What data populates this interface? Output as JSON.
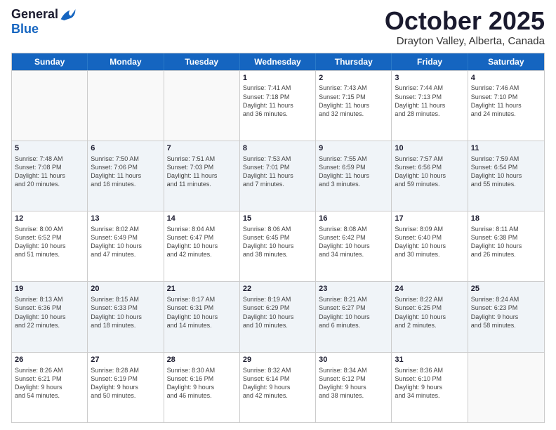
{
  "header": {
    "logo_general": "General",
    "logo_blue": "Blue",
    "month_title": "October 2025",
    "subtitle": "Drayton Valley, Alberta, Canada"
  },
  "days_of_week": [
    "Sunday",
    "Monday",
    "Tuesday",
    "Wednesday",
    "Thursday",
    "Friday",
    "Saturday"
  ],
  "rows": [
    {
      "alt": false,
      "cells": [
        {
          "day": "",
          "info": ""
        },
        {
          "day": "",
          "info": ""
        },
        {
          "day": "",
          "info": ""
        },
        {
          "day": "1",
          "info": "Sunrise: 7:41 AM\nSunset: 7:18 PM\nDaylight: 11 hours\nand 36 minutes."
        },
        {
          "day": "2",
          "info": "Sunrise: 7:43 AM\nSunset: 7:15 PM\nDaylight: 11 hours\nand 32 minutes."
        },
        {
          "day": "3",
          "info": "Sunrise: 7:44 AM\nSunset: 7:13 PM\nDaylight: 11 hours\nand 28 minutes."
        },
        {
          "day": "4",
          "info": "Sunrise: 7:46 AM\nSunset: 7:10 PM\nDaylight: 11 hours\nand 24 minutes."
        }
      ]
    },
    {
      "alt": true,
      "cells": [
        {
          "day": "5",
          "info": "Sunrise: 7:48 AM\nSunset: 7:08 PM\nDaylight: 11 hours\nand 20 minutes."
        },
        {
          "day": "6",
          "info": "Sunrise: 7:50 AM\nSunset: 7:06 PM\nDaylight: 11 hours\nand 16 minutes."
        },
        {
          "day": "7",
          "info": "Sunrise: 7:51 AM\nSunset: 7:03 PM\nDaylight: 11 hours\nand 11 minutes."
        },
        {
          "day": "8",
          "info": "Sunrise: 7:53 AM\nSunset: 7:01 PM\nDaylight: 11 hours\nand 7 minutes."
        },
        {
          "day": "9",
          "info": "Sunrise: 7:55 AM\nSunset: 6:59 PM\nDaylight: 11 hours\nand 3 minutes."
        },
        {
          "day": "10",
          "info": "Sunrise: 7:57 AM\nSunset: 6:56 PM\nDaylight: 10 hours\nand 59 minutes."
        },
        {
          "day": "11",
          "info": "Sunrise: 7:59 AM\nSunset: 6:54 PM\nDaylight: 10 hours\nand 55 minutes."
        }
      ]
    },
    {
      "alt": false,
      "cells": [
        {
          "day": "12",
          "info": "Sunrise: 8:00 AM\nSunset: 6:52 PM\nDaylight: 10 hours\nand 51 minutes."
        },
        {
          "day": "13",
          "info": "Sunrise: 8:02 AM\nSunset: 6:49 PM\nDaylight: 10 hours\nand 47 minutes."
        },
        {
          "day": "14",
          "info": "Sunrise: 8:04 AM\nSunset: 6:47 PM\nDaylight: 10 hours\nand 42 minutes."
        },
        {
          "day": "15",
          "info": "Sunrise: 8:06 AM\nSunset: 6:45 PM\nDaylight: 10 hours\nand 38 minutes."
        },
        {
          "day": "16",
          "info": "Sunrise: 8:08 AM\nSunset: 6:42 PM\nDaylight: 10 hours\nand 34 minutes."
        },
        {
          "day": "17",
          "info": "Sunrise: 8:09 AM\nSunset: 6:40 PM\nDaylight: 10 hours\nand 30 minutes."
        },
        {
          "day": "18",
          "info": "Sunrise: 8:11 AM\nSunset: 6:38 PM\nDaylight: 10 hours\nand 26 minutes."
        }
      ]
    },
    {
      "alt": true,
      "cells": [
        {
          "day": "19",
          "info": "Sunrise: 8:13 AM\nSunset: 6:36 PM\nDaylight: 10 hours\nand 22 minutes."
        },
        {
          "day": "20",
          "info": "Sunrise: 8:15 AM\nSunset: 6:33 PM\nDaylight: 10 hours\nand 18 minutes."
        },
        {
          "day": "21",
          "info": "Sunrise: 8:17 AM\nSunset: 6:31 PM\nDaylight: 10 hours\nand 14 minutes."
        },
        {
          "day": "22",
          "info": "Sunrise: 8:19 AM\nSunset: 6:29 PM\nDaylight: 10 hours\nand 10 minutes."
        },
        {
          "day": "23",
          "info": "Sunrise: 8:21 AM\nSunset: 6:27 PM\nDaylight: 10 hours\nand 6 minutes."
        },
        {
          "day": "24",
          "info": "Sunrise: 8:22 AM\nSunset: 6:25 PM\nDaylight: 10 hours\nand 2 minutes."
        },
        {
          "day": "25",
          "info": "Sunrise: 8:24 AM\nSunset: 6:23 PM\nDaylight: 9 hours\nand 58 minutes."
        }
      ]
    },
    {
      "alt": false,
      "cells": [
        {
          "day": "26",
          "info": "Sunrise: 8:26 AM\nSunset: 6:21 PM\nDaylight: 9 hours\nand 54 minutes."
        },
        {
          "day": "27",
          "info": "Sunrise: 8:28 AM\nSunset: 6:19 PM\nDaylight: 9 hours\nand 50 minutes."
        },
        {
          "day": "28",
          "info": "Sunrise: 8:30 AM\nSunset: 6:16 PM\nDaylight: 9 hours\nand 46 minutes."
        },
        {
          "day": "29",
          "info": "Sunrise: 8:32 AM\nSunset: 6:14 PM\nDaylight: 9 hours\nand 42 minutes."
        },
        {
          "day": "30",
          "info": "Sunrise: 8:34 AM\nSunset: 6:12 PM\nDaylight: 9 hours\nand 38 minutes."
        },
        {
          "day": "31",
          "info": "Sunrise: 8:36 AM\nSunset: 6:10 PM\nDaylight: 9 hours\nand 34 minutes."
        },
        {
          "day": "",
          "info": ""
        }
      ]
    }
  ]
}
